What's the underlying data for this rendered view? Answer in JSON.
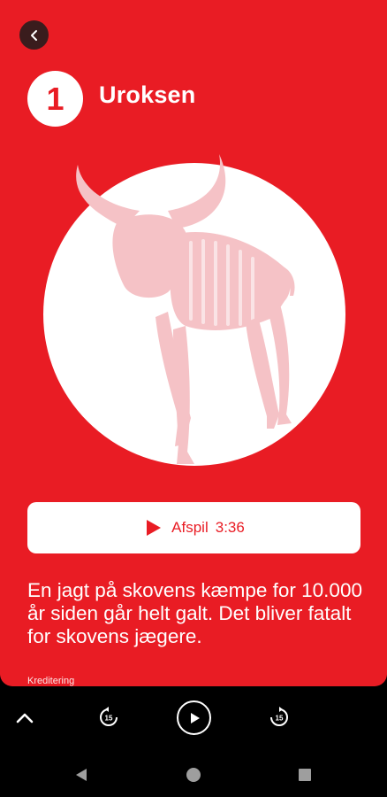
{
  "header": {
    "back_icon": "chevron-left-icon",
    "chapter_number": "1",
    "title": "Uroksen"
  },
  "player": {
    "play_label": "Afspil",
    "duration": "3:36"
  },
  "description": "En jagt på skovens kæmpe for 10.000 år siden går helt galt. Det bliver fatalt for skovens jægere.",
  "credits_label": "Kreditering",
  "mini_player": {
    "expand_icon": "chevron-up-icon",
    "rewind_label": "15",
    "forward_label": "15",
    "play_icon": "play-icon"
  },
  "colors": {
    "accent": "#e91c24",
    "silhouette": "#f5c2c6",
    "background": "#000000"
  }
}
